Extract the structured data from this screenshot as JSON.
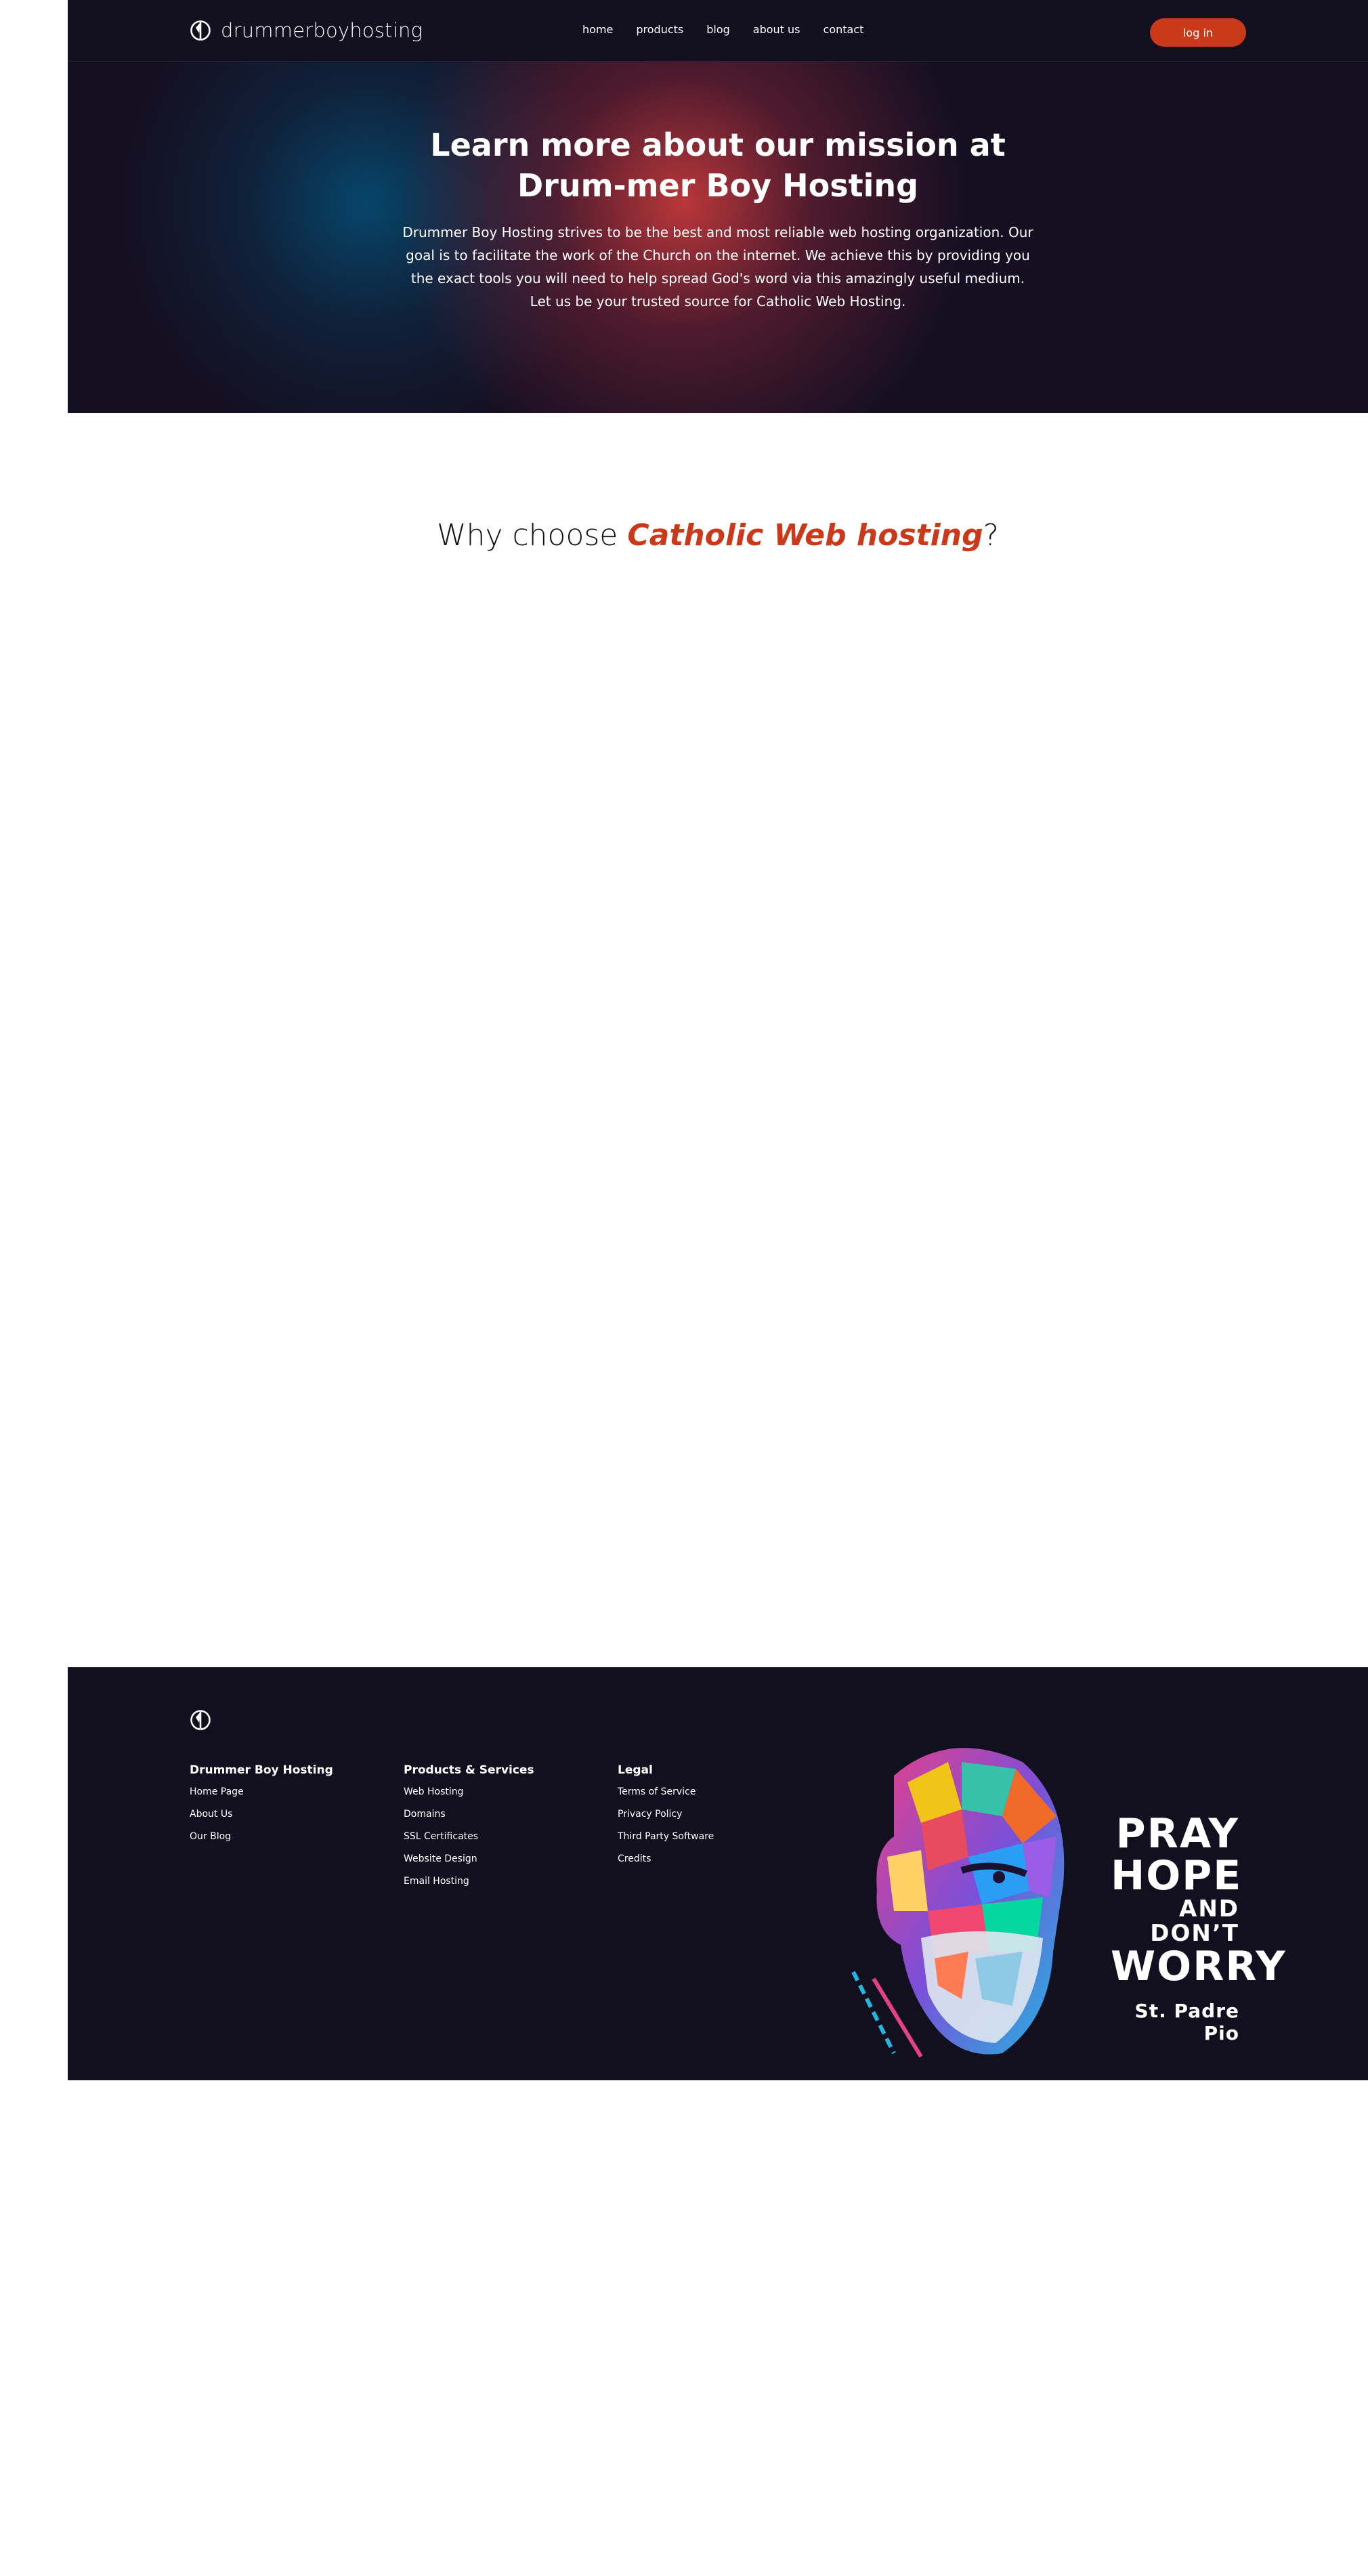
{
  "nav": {
    "brand": "drummerboyhosting",
    "links": [
      "home",
      "products",
      "blog",
      "about us",
      "contact"
    ],
    "login": "log in"
  },
  "hero": {
    "title": "Learn more about our mission at Drum-mer Boy Hosting",
    "text": "Drummer Boy Hosting strives to be the best and most reliable web hosting organization. Our goal is to facilitate the work of the Church on the internet. We achieve this by providing you the exact tools you will need to help spread God's word via this amazingly useful medium. Let us be your trusted source for Catholic Web Hosting."
  },
  "why": {
    "prefix": "Why choose",
    "accent": "Catholic Web hosting",
    "suffix": "?"
  },
  "footer": {
    "columns": [
      {
        "title": "Drummer Boy Hosting",
        "links": [
          "Home Page",
          "About Us",
          "Our Blog"
        ]
      },
      {
        "title": "Products & Services",
        "links": [
          "Web Hosting",
          "Domains",
          "SSL Certificates",
          "Website Design",
          "Email Hosting"
        ]
      },
      {
        "title": "Legal",
        "links": [
          "Terms of Service",
          "Privacy Policy",
          "Third Party Software",
          "Credits"
        ]
      }
    ],
    "promo": {
      "line1": "PRAY",
      "line2": "HOPE",
      "line3": "AND DON’T",
      "line4": "WORRY",
      "signature": "St. Padre Pio"
    }
  },
  "colors": {
    "accent": "#c9391a",
    "dark_bg": "#12101f",
    "hero_red": "#d63e3e",
    "hero_blue": "#06486e"
  },
  "icons": [
    "drum-logo-icon"
  ]
}
